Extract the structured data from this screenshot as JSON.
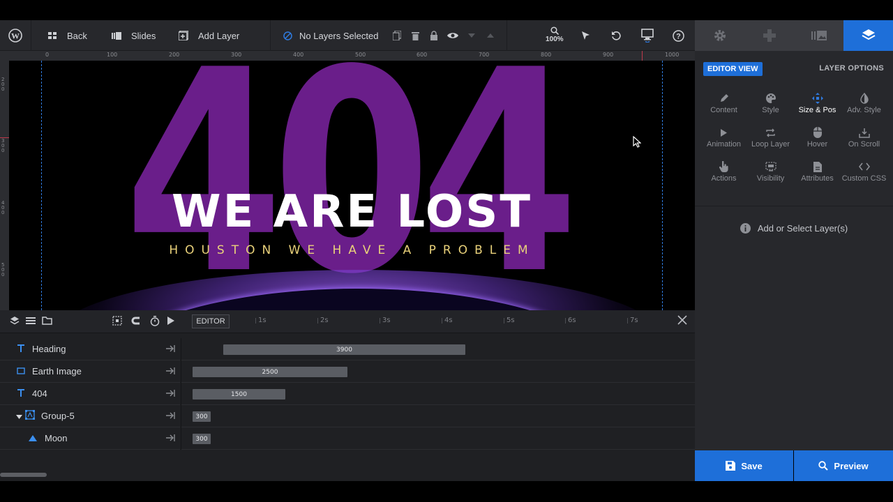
{
  "toolbar": {
    "back_label": "Back",
    "slides_label": "Slides",
    "add_layer_label": "Add Layer",
    "selection_label": "No Layers Selected",
    "zoom_label": "100%"
  },
  "ruler": {
    "marks": [
      "0",
      "100",
      "200",
      "300",
      "400",
      "500",
      "600",
      "700",
      "800",
      "900",
      "1000"
    ],
    "vmarks": [
      "200",
      "300",
      "400",
      "500"
    ]
  },
  "canvas": {
    "big_text": "404",
    "heading": "WE ARE LOST",
    "subheading": "HOUSTON WE HAVE A PROBLEM"
  },
  "timeline": {
    "editor_tag": "EDITOR",
    "seconds": [
      "1s",
      "2s",
      "3s",
      "4s",
      "5s",
      "6s",
      "7s"
    ],
    "layers": [
      {
        "name": "Heading",
        "icon": "text-icon",
        "duration": "3900"
      },
      {
        "name": "Earth Image",
        "icon": "image-icon",
        "duration": "2500"
      },
      {
        "name": "404",
        "icon": "text-icon",
        "duration": "1500"
      },
      {
        "name": "Group-5",
        "icon": "group-icon",
        "duration": "300"
      },
      {
        "name": "Moon",
        "icon": "shape-icon",
        "duration": "300"
      }
    ]
  },
  "panel": {
    "editor_view_label": "EDITOR VIEW",
    "layer_options_label": "LAYER OPTIONS",
    "options": [
      {
        "label": "Content",
        "icon": "pencil-icon"
      },
      {
        "label": "Style",
        "icon": "palette-icon"
      },
      {
        "label": "Size & Pos",
        "icon": "move-icon"
      },
      {
        "label": "Adv. Style",
        "icon": "contrast-icon"
      },
      {
        "label": "Animation",
        "icon": "play-icon"
      },
      {
        "label": "Loop Layer",
        "icon": "loop-icon"
      },
      {
        "label": "Hover",
        "icon": "mouse-icon"
      },
      {
        "label": "On Scroll",
        "icon": "scroll-icon"
      },
      {
        "label": "Actions",
        "icon": "pointer-hand-icon"
      },
      {
        "label": "Visibility",
        "icon": "visibility-icon"
      },
      {
        "label": "Attributes",
        "icon": "file-icon"
      },
      {
        "label": "Custom CSS",
        "icon": "code-icon"
      }
    ],
    "active_option": "Size & Pos",
    "empty_message": "Add or Select Layer(s)"
  },
  "footer": {
    "save_label": "Save",
    "preview_label": "Preview"
  },
  "colors": {
    "accent": "#1e6fd9",
    "big_text": "#6a1e8a",
    "subheading": "#e9d17a"
  }
}
